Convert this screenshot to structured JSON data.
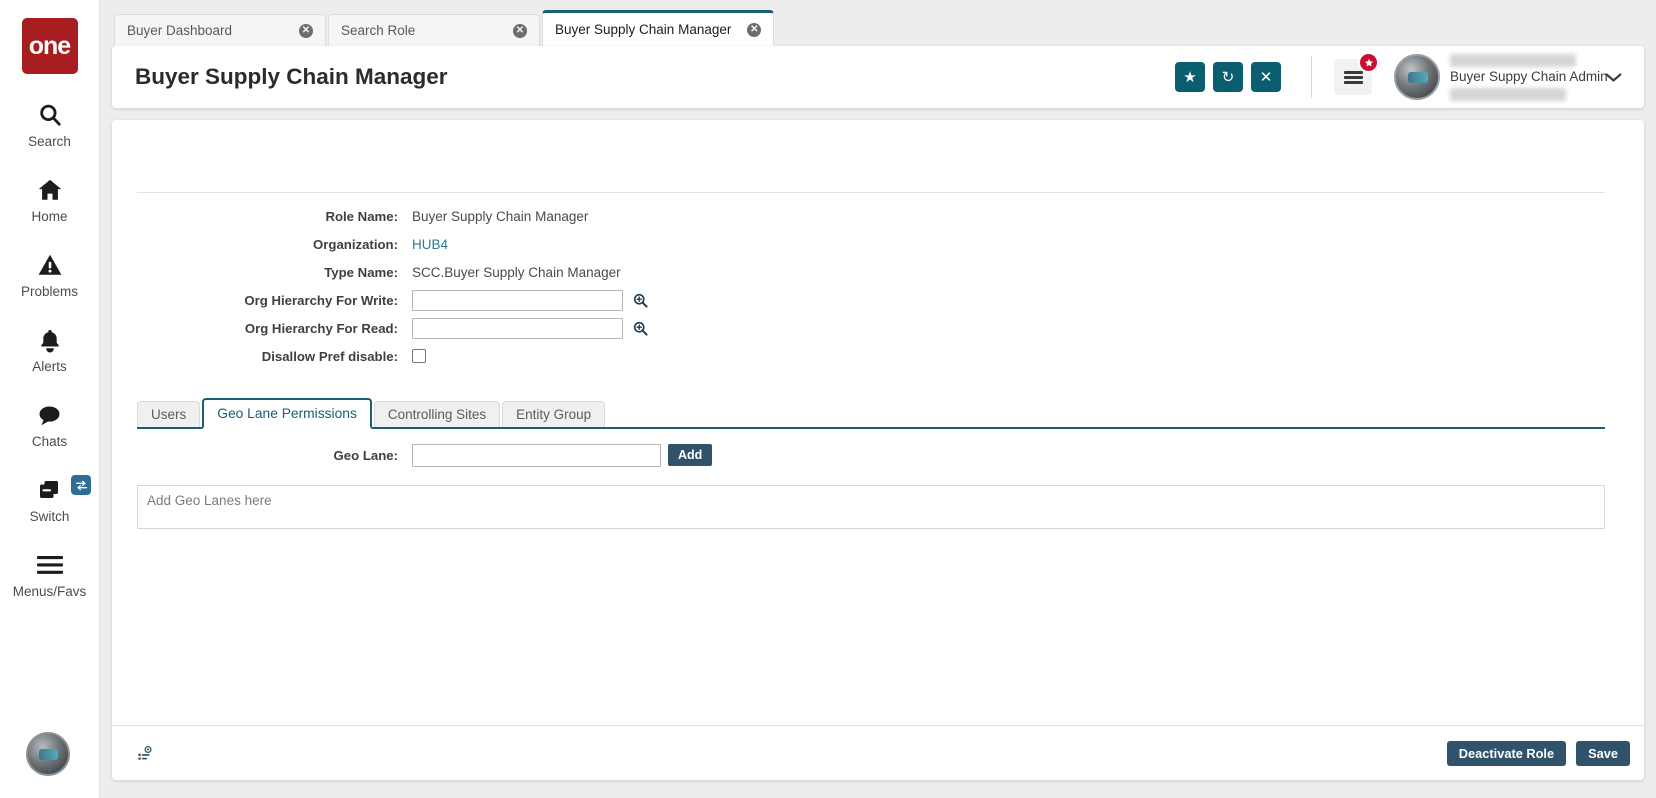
{
  "app": {
    "logo_text": "one",
    "accent_teal": "#0a5e70",
    "accent_navy": "#30536b",
    "tab_accent": "#1b5d72",
    "logo_red": "#a81d20"
  },
  "rail": {
    "items": [
      {
        "label": "Search",
        "icon": "search-icon"
      },
      {
        "label": "Home",
        "icon": "home-icon"
      },
      {
        "label": "Problems",
        "icon": "warning-icon"
      },
      {
        "label": "Alerts",
        "icon": "bell-icon"
      },
      {
        "label": "Chats",
        "icon": "chat-icon"
      },
      {
        "label": "Switch",
        "icon": "switch-icon"
      },
      {
        "label": "Menus/Favs",
        "icon": "hamburger-icon"
      }
    ]
  },
  "browser_tabs": [
    {
      "label": "Buyer Dashboard",
      "active": false,
      "close": "✕"
    },
    {
      "label": "Search Role",
      "active": false,
      "close": "✕"
    },
    {
      "label": "Buyer Supply Chain Manager",
      "active": true,
      "close": "✕"
    }
  ],
  "header": {
    "title": "Buyer Supply Chain Manager",
    "buttons": [
      {
        "name": "favorite-button",
        "glyph": "★"
      },
      {
        "name": "refresh-button",
        "glyph": "↻"
      },
      {
        "name": "close-button",
        "glyph": "✕"
      }
    ],
    "user_name": "Buyer Suppy Chain Admin",
    "caret": "⌄"
  },
  "form": {
    "fields": [
      {
        "label": "Role Name:",
        "value": "Buyer Supply Chain Manager",
        "type": "text"
      },
      {
        "label": "Organization:",
        "value": "HUB4",
        "type": "link"
      },
      {
        "label": "Type Name:",
        "value": "SCC.Buyer Supply Chain Manager",
        "type": "text"
      },
      {
        "label": "Org Hierarchy For Write:",
        "value": "",
        "placeholder": "",
        "type": "lookup"
      },
      {
        "label": "Org Hierarchy For Read:",
        "value": "",
        "placeholder": "",
        "type": "lookup"
      },
      {
        "label": "Disallow Pref disable:",
        "value": "",
        "type": "checkbox",
        "checked": false
      }
    ]
  },
  "panel_tabs": [
    {
      "label": "Users",
      "active": false
    },
    {
      "label": "Geo Lane Permissions",
      "active": true
    },
    {
      "label": "Controlling Sites",
      "active": false
    },
    {
      "label": "Entity Group",
      "active": false
    }
  ],
  "geo_lane": {
    "label": "Geo Lane:",
    "value": "",
    "placeholder": "",
    "add_label": "Add",
    "dropzone_text": "Add Geo Lanes here"
  },
  "footer": {
    "deactivate_label": "Deactivate Role",
    "save_label": "Save"
  }
}
